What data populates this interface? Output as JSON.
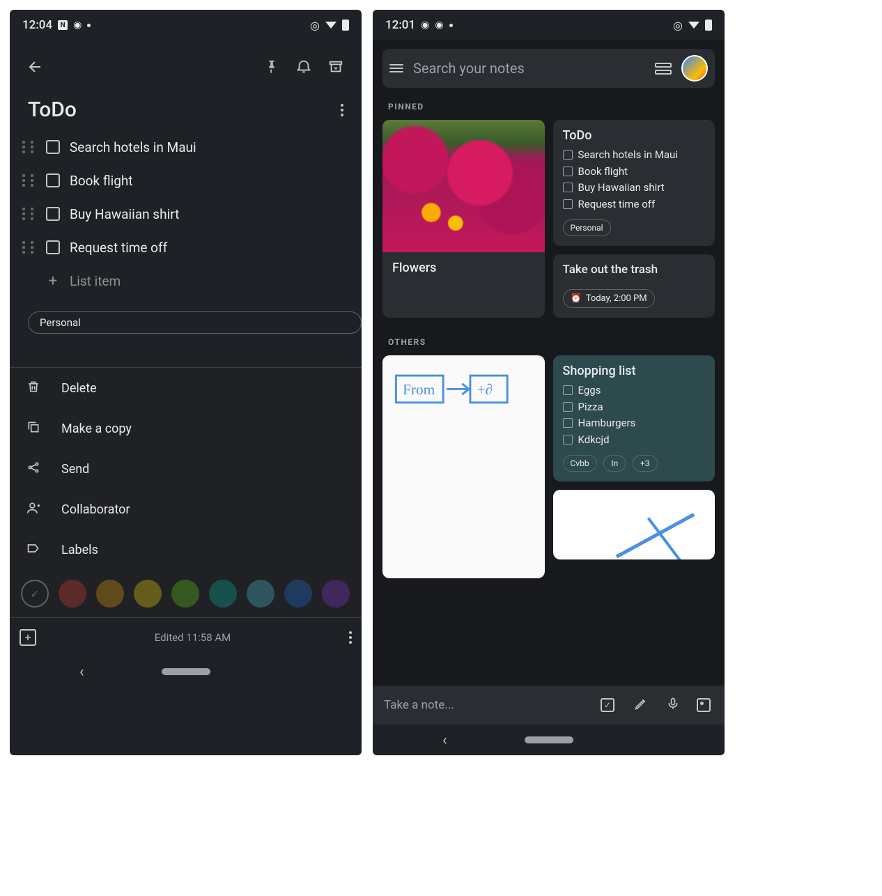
{
  "left": {
    "status": {
      "time": "12:04"
    },
    "note": {
      "title": "ToDo",
      "items": [
        "Search hotels in Maui",
        "Book flight",
        "Buy Hawaiian shirt",
        "Request time off"
      ],
      "add_item_placeholder": "List item",
      "label": "Personal"
    },
    "sheet": {
      "delete": "Delete",
      "copy": "Make a copy",
      "send": "Send",
      "collab": "Collaborator",
      "labels": "Labels",
      "colors": [
        "#5c2b29",
        "#614a19",
        "#635d19",
        "#345920",
        "#16504b",
        "#2d555e",
        "#1e3a5f",
        "#42275e"
      ]
    },
    "footer": {
      "edited": "Edited 11:58 AM"
    }
  },
  "right": {
    "status": {
      "time": "12:01"
    },
    "search_placeholder": "Search your notes",
    "section_pinned": "PINNED",
    "section_others": "OTHERS",
    "card_flowers_title": "Flowers",
    "card_todo": {
      "title": "ToDo",
      "items": [
        "Search hotels in Maui",
        "Book flight",
        "Buy Hawaiian shirt",
        "Request time off"
      ],
      "label": "Personal"
    },
    "card_trash": {
      "title": "Take out the trash",
      "reminder": "Today, 2:00 PM"
    },
    "card_shopping": {
      "title": "Shopping list",
      "items": [
        "Eggs",
        "Pizza",
        "Hamburgers",
        "Kdkcjd"
      ],
      "chips": [
        "Cvbb",
        "In",
        "+3"
      ]
    },
    "footer": {
      "take_note": "Take a note..."
    }
  }
}
